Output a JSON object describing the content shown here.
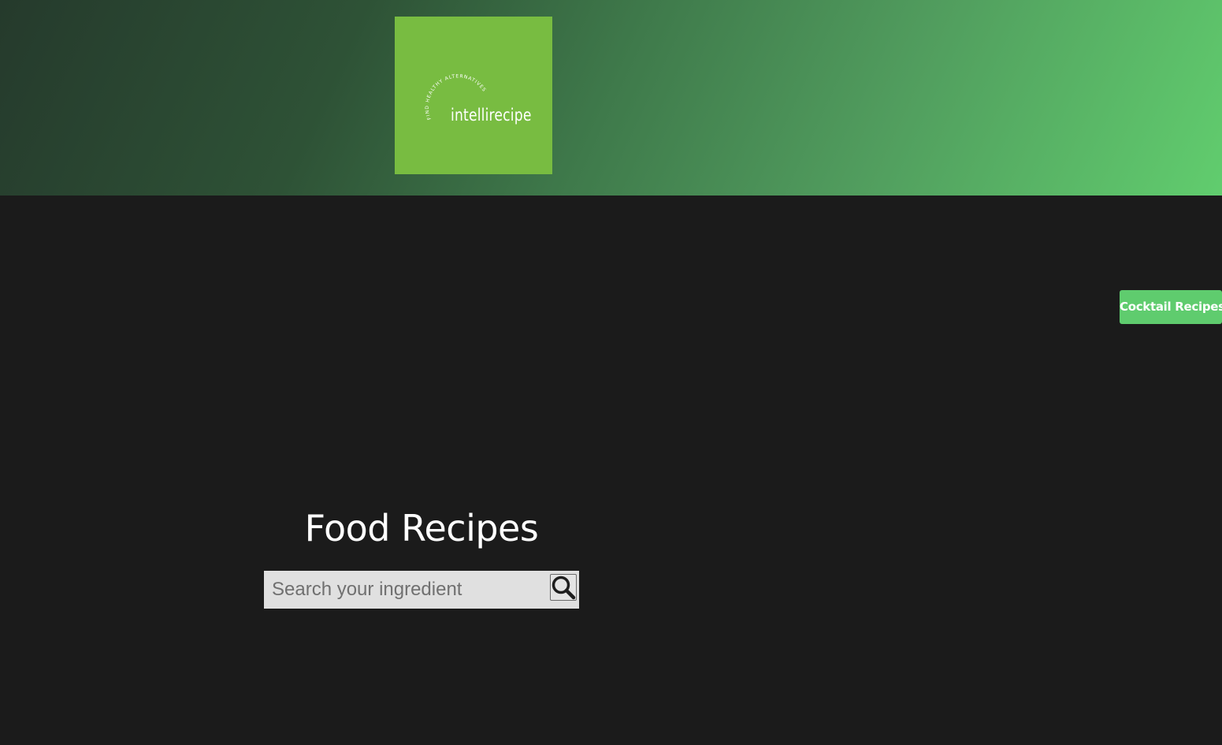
{
  "logo": {
    "tagline": "FIND HEALTHY ALTERNATIVES",
    "wordmark": "intellirecipe",
    "background_color": "#78bc41"
  },
  "nav": {
    "cocktail_label": "Cocktail Recipes",
    "accent_color": "#5fcc6e"
  },
  "main": {
    "title": "Food Recipes",
    "search": {
      "placeholder": "Search your ingredient",
      "value": "",
      "icon": "search-icon"
    }
  },
  "colors": {
    "page_background": "#1b1b1b",
    "header_gradient_start": "#253a2c",
    "header_gradient_end": "#61cd6e"
  }
}
